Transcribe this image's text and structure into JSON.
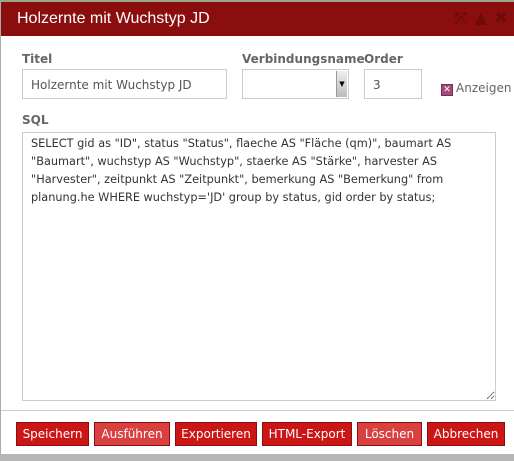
{
  "dialog": {
    "title": "Holzernte mit Wuchstyp JD"
  },
  "fields": {
    "titel_label": "Titel",
    "titel_value": "Holzernte mit Wuchstyp JD",
    "verbindung_label": "Verbindungsname",
    "verbindung_value": "",
    "order_label": "Order",
    "order_value": "3",
    "anzeigen_label": "Anzeigen",
    "sql_label": "SQL",
    "sql_value": "SELECT gid as \"ID\", status \"Status\", flaeche AS \"Fläche (qm)\", baumart AS \"Baumart\", wuchstyp AS \"Wuchstyp\", staerke AS \"Stärke\", harvester AS \"Harvester\", zeitpunkt AS \"Zeitpunkt\", bemerkung AS \"Bemerkung\" from planung.he WHERE wuchstyp='JD' group by status, gid order by status;"
  },
  "buttons": {
    "save": "Speichern",
    "run": "Ausführen",
    "export": "Exportieren",
    "html_export": "HTML-Export",
    "delete": "Löschen",
    "cancel": "Abbrechen"
  },
  "colors": {
    "titlebar": "#8a0e0e",
    "button": "#cc1515",
    "button_light": "#d94040"
  }
}
